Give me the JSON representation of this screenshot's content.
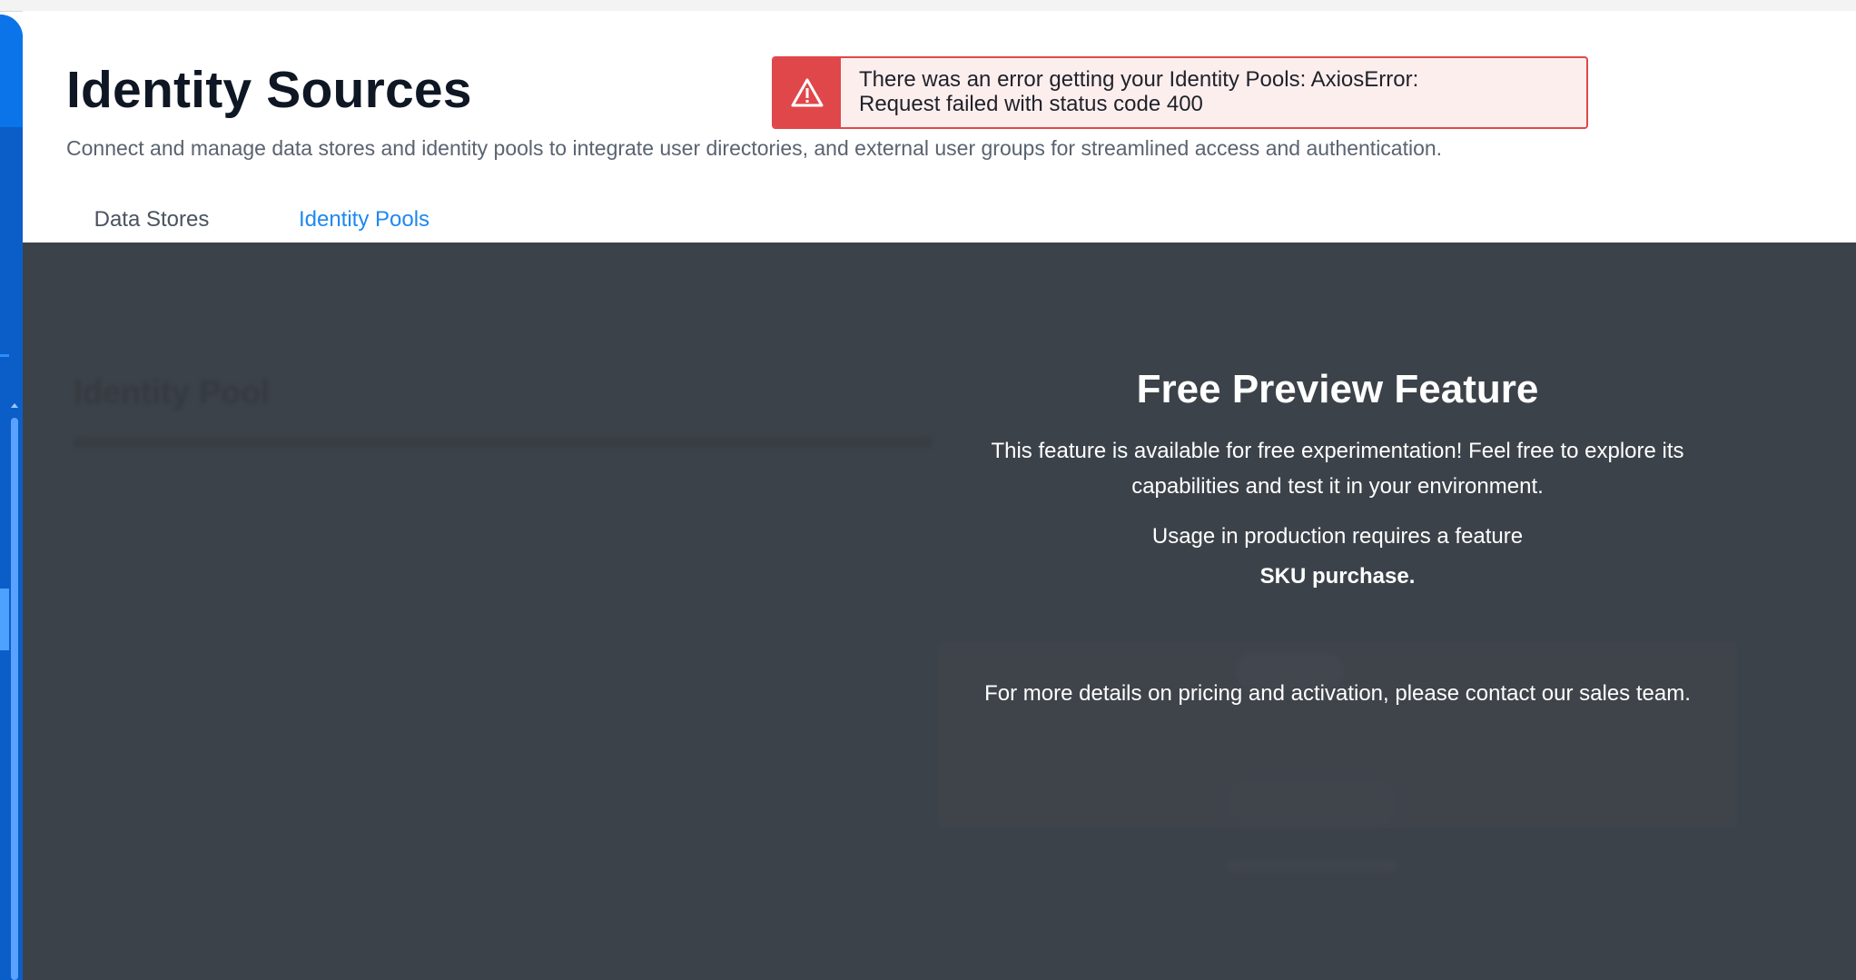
{
  "header": {
    "title": "Identity Sources",
    "description": "Connect and manage data stores and identity pools to integrate user directories, and external user groups for streamlined access and authentication."
  },
  "tabs": [
    {
      "label": "Data Stores",
      "active": false
    },
    {
      "label": "Identity Pools",
      "active": true
    }
  ],
  "toast": {
    "icon": "warning-triangle-icon",
    "message_line1": "There was an error getting your Identity Pools: AxiosError:",
    "message_line2": "Request failed with status code 400"
  },
  "background": {
    "section_title": "Identity Pool"
  },
  "preview": {
    "title": "Free Preview Feature",
    "paragraph1": "This feature is available for free experimentation! Feel free to explore its capabilities and test it in your environment.",
    "paragraph2": "Usage in production requires a feature",
    "sku": "SKU purchase.",
    "paragraph3": "For more details on pricing and activation, please contact our sales team."
  },
  "colors": {
    "accent": "#1e88f0",
    "error": "#e0474a",
    "error_bg": "#fdeeee",
    "overlay": "#3c4249",
    "sidebar": "#0b5ec8"
  }
}
